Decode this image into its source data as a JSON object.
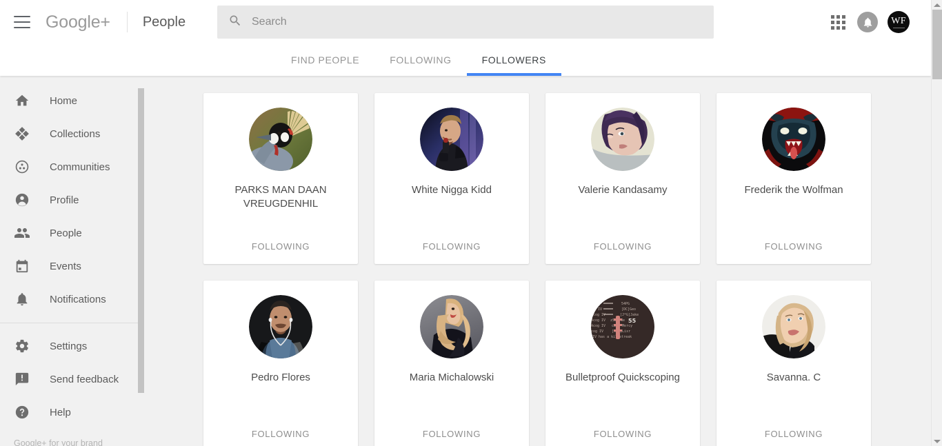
{
  "header": {
    "menu_icon": "hamburger-icon",
    "brand": "Google+",
    "section_title": "People",
    "search": {
      "icon": "search-icon",
      "placeholder": "Search",
      "value": ""
    },
    "apps_icon": "apps-grid-icon",
    "notifications_icon": "bell-icon",
    "account": {
      "initials": "WF"
    }
  },
  "tabs": [
    {
      "label": "FIND PEOPLE",
      "active": false
    },
    {
      "label": "FOLLOWING",
      "active": false
    },
    {
      "label": "FOLLOWERS",
      "active": true
    }
  ],
  "accent_color": "#4285f4",
  "sidebar": {
    "items": [
      {
        "label": "Home",
        "icon": "home-icon"
      },
      {
        "label": "Collections",
        "icon": "collections-icon"
      },
      {
        "label": "Communities",
        "icon": "communities-icon"
      },
      {
        "label": "Profile",
        "icon": "profile-icon"
      },
      {
        "label": "People",
        "icon": "people-icon"
      },
      {
        "label": "Events",
        "icon": "events-icon"
      },
      {
        "label": "Notifications",
        "icon": "bell-icon"
      }
    ],
    "items_secondary": [
      {
        "label": "Settings",
        "icon": "gear-icon"
      },
      {
        "label": "Send feedback",
        "icon": "feedback-icon"
      },
      {
        "label": "Help",
        "icon": "help-icon"
      }
    ],
    "footer_label": "Google+ for your brand"
  },
  "people": [
    {
      "name": "PARKS MAN DAAN VREUGDENHIL",
      "action": "FOLLOWING",
      "avatar": "crowned-crane-photo"
    },
    {
      "name": "White Nigga Kidd",
      "action": "FOLLOWING",
      "avatar": "wrestler-microphone-photo"
    },
    {
      "name": "Valerie Kandasamy",
      "action": "FOLLOWING",
      "avatar": "purple-hair-portrait-photo"
    },
    {
      "name": "Frederik the Wolfman",
      "action": "FOLLOWING",
      "avatar": "werewolf-illustration"
    },
    {
      "name": "Pedro Flores",
      "action": "FOLLOWING",
      "avatar": "man-earbuds-photo"
    },
    {
      "name": "Maria Michalowski",
      "action": "FOLLOWING",
      "avatar": "blonde-woman-photo"
    },
    {
      "name": "Bulletproof Quickscoping",
      "action": "FOLLOWING",
      "avatar": "game-killfeed-screenshot"
    },
    {
      "name": "Savanna. C",
      "action": "FOLLOWING",
      "avatar": "blonde-woman-black-top-photo"
    }
  ]
}
